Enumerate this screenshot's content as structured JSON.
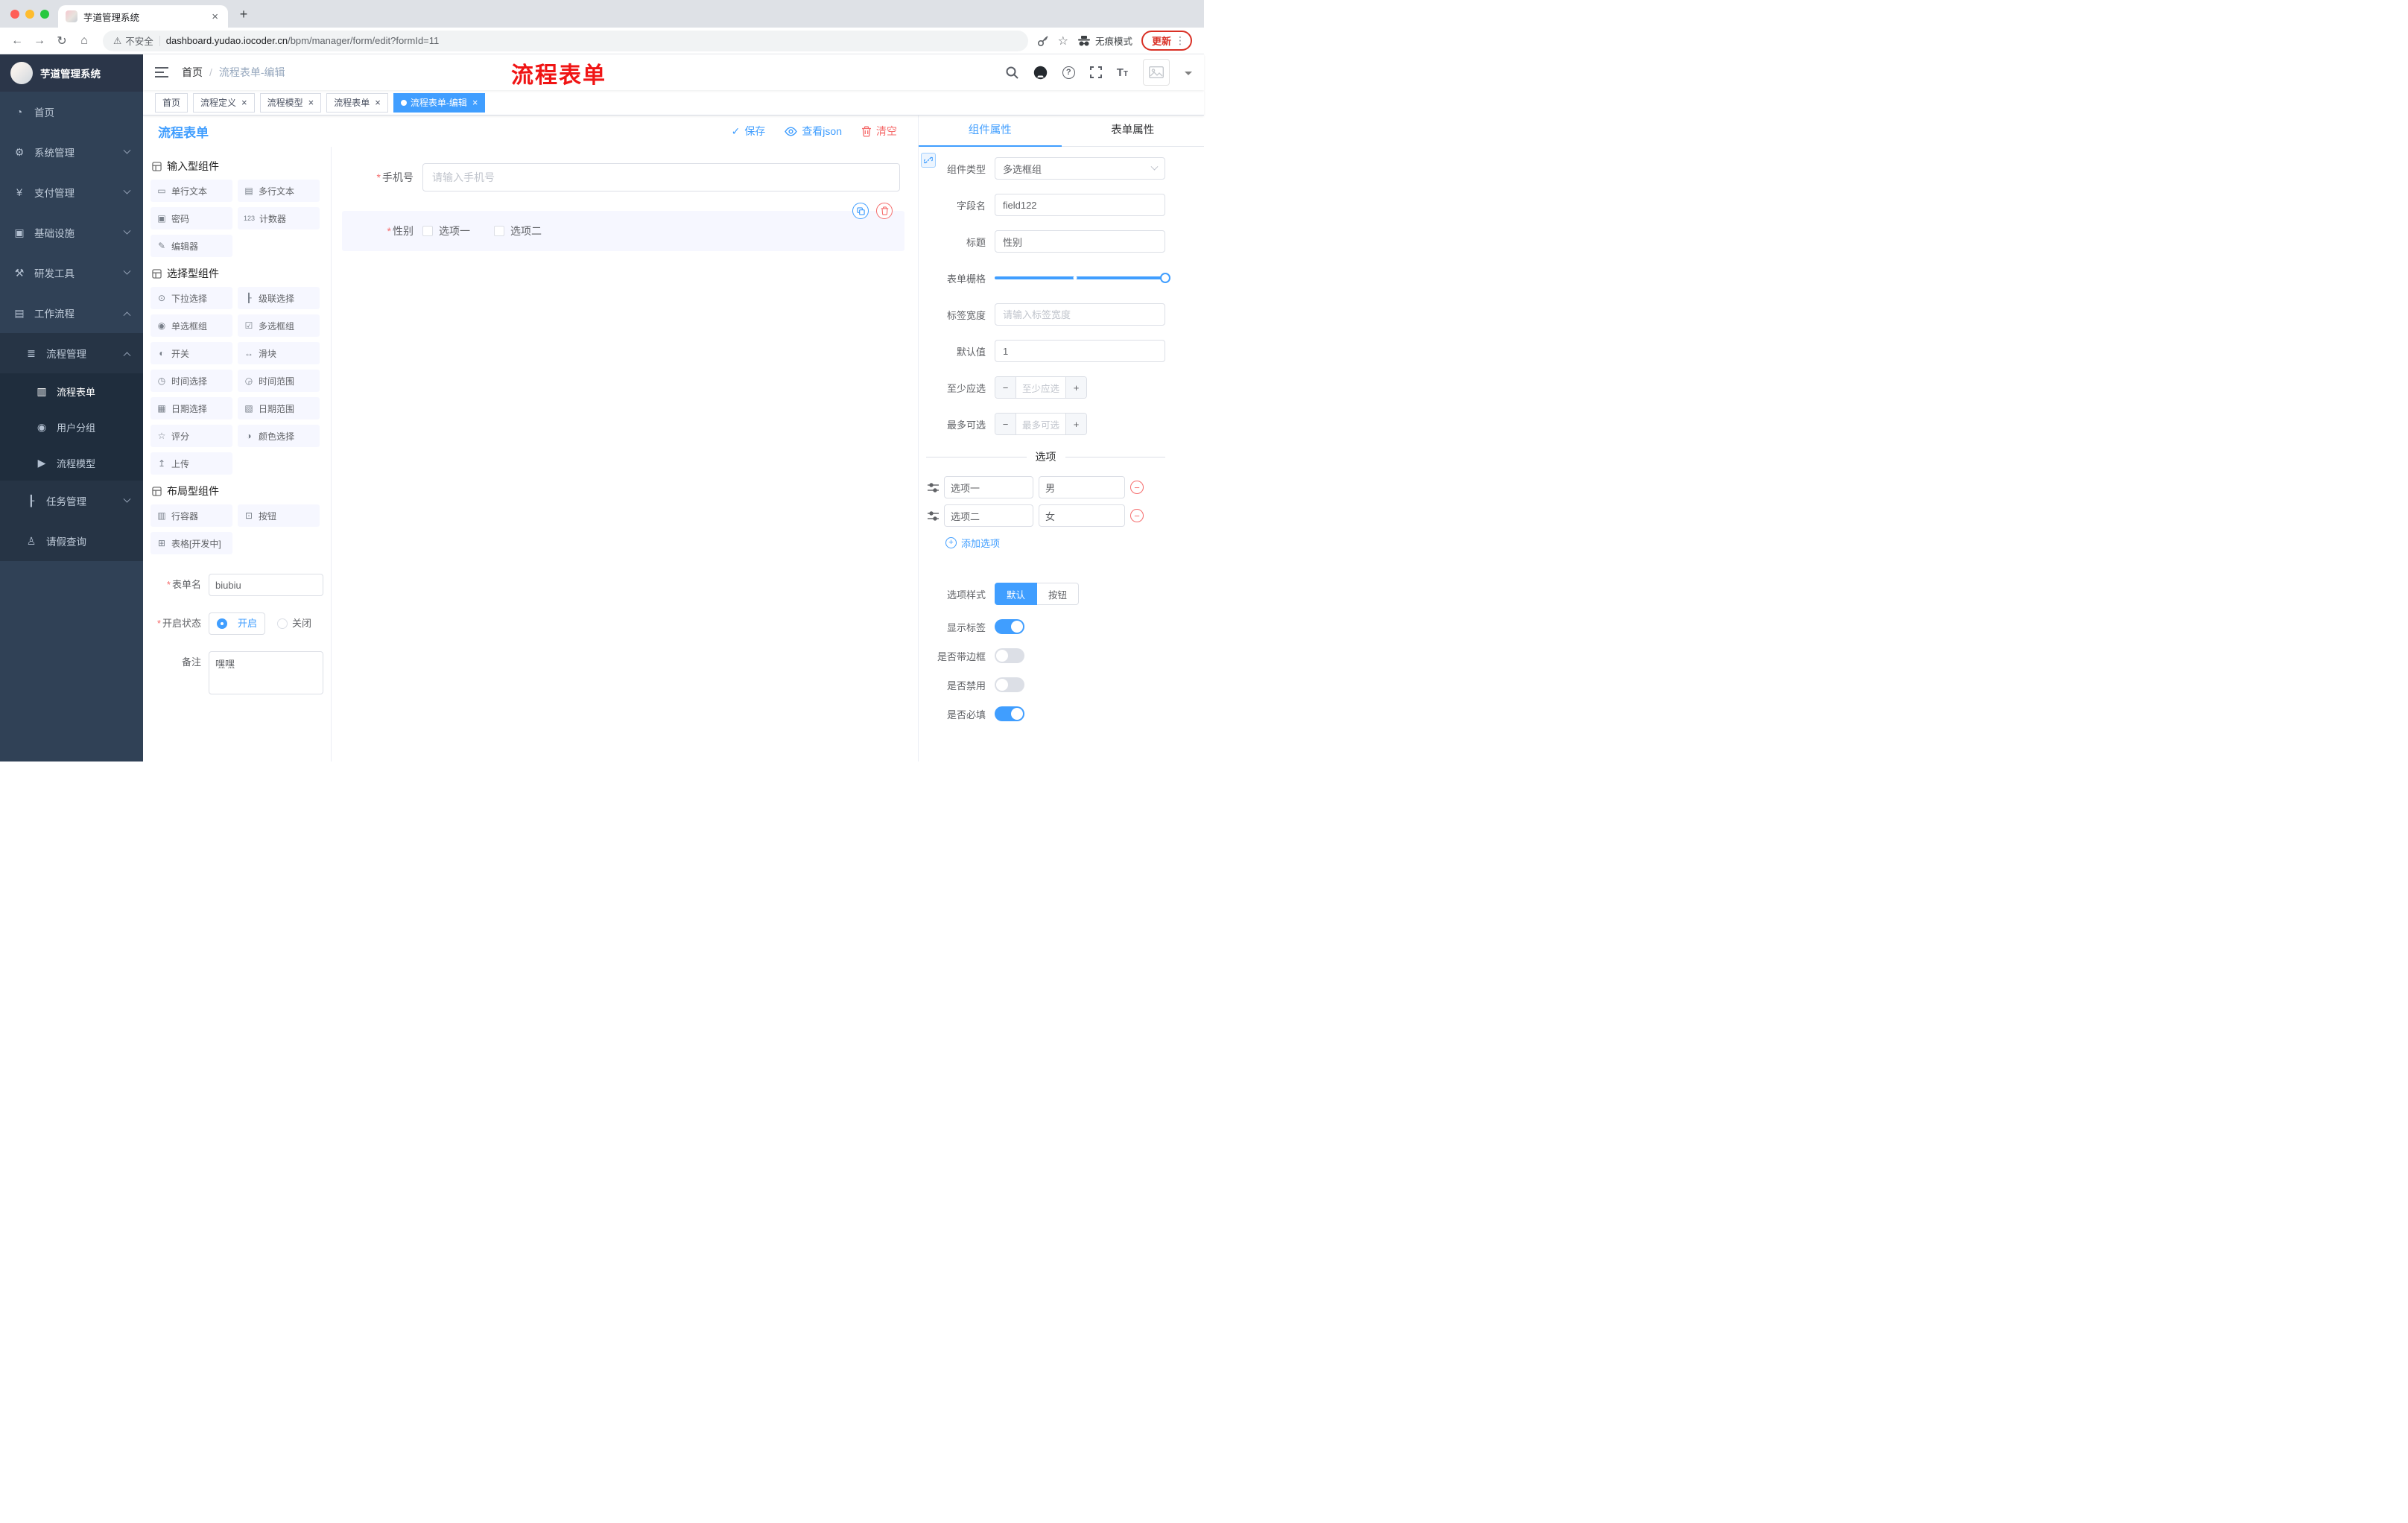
{
  "colors": {
    "primary": "#409eff",
    "danger": "#f56c6c",
    "annotation_red": "#f01414",
    "sidebar_bg": "#304156",
    "tag_active_bg": "#409eff",
    "update_badge": "#d93025"
  },
  "icons": {
    "back": "←",
    "forward": "→",
    "reload": "↻",
    "home": "⌂",
    "warning": "⚠",
    "star": "☆",
    "dots_vertical": "⋮",
    "close": "×",
    "new_tab": "+",
    "check": "✓",
    "plus": "+",
    "minus": "−",
    "help": "?",
    "font_size_big": "T",
    "font_size_small": "T"
  },
  "browser": {
    "tab_title": "芋道管理系统",
    "security_label": "不安全",
    "url_host": "dashboard.yudao.iocoder.cn",
    "url_path": "/bpm/manager/form/edit?formId=11",
    "incognito_label": "无痕模式",
    "update_label": "更新"
  },
  "sidebar": {
    "logo_title": "芋道管理系统",
    "menu": [
      {
        "icon": "◔",
        "label": "首页"
      },
      {
        "icon": "⚙",
        "label": "系统管理"
      },
      {
        "icon": "¥",
        "label": "支付管理"
      },
      {
        "icon": "▣",
        "label": "基础设施"
      },
      {
        "icon": "⚒",
        "label": "研发工具"
      },
      {
        "icon": "▤",
        "label": "工作流程"
      }
    ],
    "submenu_parent": {
      "icon": "≣",
      "label": "流程管理"
    },
    "submenu_children": [
      {
        "icon": "▥",
        "label": "流程表单"
      },
      {
        "icon": "◉",
        "label": "用户分组"
      },
      {
        "icon": "▶",
        "label": "流程模型"
      }
    ],
    "submenu_siblings": [
      {
        "icon": "┠",
        "label": "任务管理"
      },
      {
        "icon": "♙",
        "label": "请假查询"
      }
    ]
  },
  "header": {
    "breadcrumb_home": "首页",
    "breadcrumb_sep": "/",
    "breadcrumb_current": "流程表单-编辑",
    "annotation": "流程表单"
  },
  "tags": [
    {
      "label": "首页"
    },
    {
      "label": "流程定义"
    },
    {
      "label": "流程模型"
    },
    {
      "label": "流程表单"
    },
    {
      "label": "流程表单-编辑"
    }
  ],
  "editor": {
    "title": "流程表单",
    "save": "保存",
    "view_json": "查看json",
    "clear": "清空"
  },
  "palette": {
    "sections": [
      {
        "title": "输入型组件",
        "items": [
          {
            "icon": "▭",
            "label": "单行文本"
          },
          {
            "icon": "▤",
            "label": "多行文本"
          },
          {
            "icon": "▣",
            "label": "密码"
          },
          {
            "icon": "123",
            "label": "计数器"
          },
          {
            "icon": "✎",
            "label": "编辑器"
          }
        ]
      },
      {
        "title": "选择型组件",
        "items": [
          {
            "icon": "⊙",
            "label": "下拉选择"
          },
          {
            "icon": "┠",
            "label": "级联选择"
          },
          {
            "icon": "◉",
            "label": "单选框组"
          },
          {
            "icon": "☑",
            "label": "多选框组"
          },
          {
            "icon": "◐",
            "label": "开关"
          },
          {
            "icon": "↔",
            "label": "滑块"
          },
          {
            "icon": "◷",
            "label": "时间选择"
          },
          {
            "icon": "◶",
            "label": "时间范围"
          },
          {
            "icon": "▦",
            "label": "日期选择"
          },
          {
            "icon": "▧",
            "label": "日期范围"
          },
          {
            "icon": "☆",
            "label": "评分"
          },
          {
            "icon": "◑",
            "label": "颜色选择"
          },
          {
            "icon": "↥",
            "label": "上传"
          }
        ]
      },
      {
        "title": "布局型组件",
        "items": [
          {
            "icon": "▥",
            "label": "行容器"
          },
          {
            "icon": "⊡",
            "label": "按钮"
          },
          {
            "icon": "⊞",
            "label": "表格[开发中]"
          }
        ]
      }
    ],
    "form": {
      "name_label": "表单名",
      "name_value": "biubiu",
      "status_label": "开启状态",
      "status_on": "开启",
      "status_off": "关闭",
      "remark_label": "备注",
      "remark_value": "嘿嘿"
    }
  },
  "canvas": {
    "phone_label": "手机号",
    "phone_placeholder": "请输入手机号",
    "gender_label": "性别",
    "gender_options": [
      {
        "label": "选项一"
      },
      {
        "label": "选项二"
      }
    ]
  },
  "props": {
    "tab_component": "组件属性",
    "tab_form": "表单属性",
    "type_label": "组件类型",
    "type_value": "多选框组",
    "field_label": "字段名",
    "field_value": "field122",
    "title_label": "标题",
    "title_value": "性别",
    "grid_label": "表单栅格",
    "width_label": "标签宽度",
    "width_placeholder": "请输入标签宽度",
    "default_label": "默认值",
    "default_value": "1",
    "min_label": "至少应选",
    "min_placeholder": "至少应选",
    "max_label": "最多可选",
    "max_placeholder": "最多可选",
    "options_title": "选项",
    "options": [
      {
        "label": "选项一",
        "value": "男"
      },
      {
        "label": "选项二",
        "value": "女"
      }
    ],
    "add_option": "添加选项",
    "style_label": "选项样式",
    "style_default": "默认",
    "style_button": "按钮",
    "toggle_show_label": "显示标签",
    "toggle_border": "是否带边框",
    "toggle_disabled": "是否禁用",
    "toggle_required": "是否必填"
  }
}
